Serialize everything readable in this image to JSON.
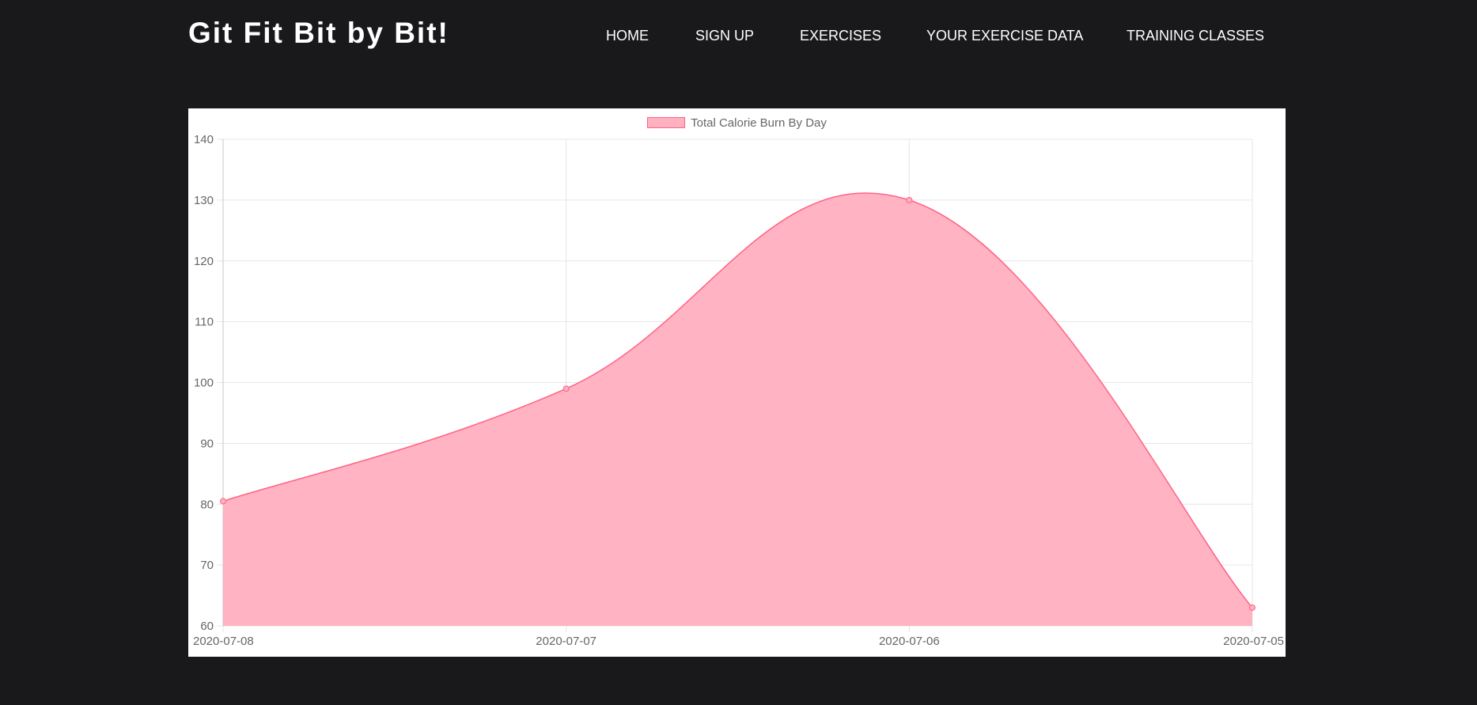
{
  "header": {
    "brand": "Git Fit Bit by Bit!",
    "nav": [
      {
        "label": "HOME"
      },
      {
        "label": "SIGN UP"
      },
      {
        "label": "EXERCISES"
      },
      {
        "label": "YOUR EXERCISE DATA"
      },
      {
        "label": "TRAINING CLASSES"
      }
    ]
  },
  "colors": {
    "page_background": "#19191b",
    "series_fill": "#ffb1c1",
    "series_line": "#ff6384"
  },
  "chart_data": {
    "type": "area",
    "legend_position": "top-center",
    "grid": true,
    "categories": [
      "2020-07-08",
      "2020-07-07",
      "2020-07-06",
      "2020-07-05"
    ],
    "series": [
      {
        "name": "Total Calorie Burn By Day",
        "values": [
          80.5,
          99,
          130,
          63
        ]
      }
    ],
    "ylim": [
      60,
      140
    ],
    "yticks": [
      60,
      70,
      80,
      90,
      100,
      110,
      120,
      130,
      140
    ]
  }
}
